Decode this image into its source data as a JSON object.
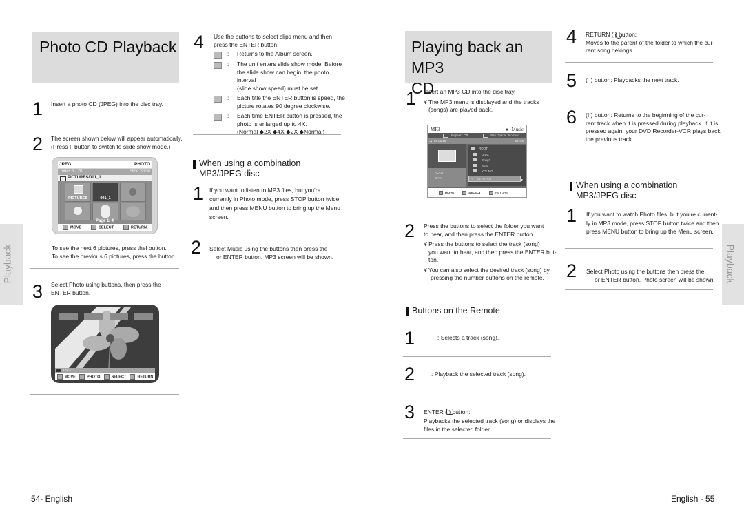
{
  "left_page": {
    "title": "Photo CD Playback",
    "side_tab": "Playback",
    "steps": [
      {
        "num": "1",
        "text": "Insert a photo CD (JPEG) into the disc tray."
      },
      {
        "num": "2",
        "text_line1": "The screen shown below will appear automatically.",
        "text_line2": "(Press   II button to switch to slide show mode.)"
      },
      {
        "num": "3",
        "text_line1": "Select Photo using      buttons, then press the",
        "text_line2": "ENTER button."
      }
    ],
    "nav_note_line1": "To see the next 6 pictures, press thel  button.",
    "nav_note_line2": "To see the previous 6 pictures, press the  button.",
    "screen1": {
      "top_left": "JPEG",
      "top_right": "PHOTO",
      "index": "Index   1 /  20",
      "slide_show": "Slide Show",
      "folder": "PICTURES/001_1",
      "thumb_labels": [
        "PICTURES",
        "001_1",
        "",
        "",
        "",
        ""
      ],
      "page": "Page 1/  4",
      "footer": [
        "MOVE",
        "SELECT",
        "RETURN"
      ]
    },
    "screen2": {
      "file": "05/31",
      "footer": [
        "MOVE",
        "PHOTO",
        "SELECT",
        "RETURN"
      ],
      "icons": [
        "grid-icon",
        "slideshow-icon",
        "rotate-icon",
        "zoom-icon"
      ]
    },
    "step4": {
      "num": "4",
      "text_line1": "Use the        buttons to select clips menu and then",
      "text_line2": "press the ENTER button.",
      "items": [
        {
          "icon": "album-grid-icon",
          "lines": [
            "Returns to the Album screen."
          ]
        },
        {
          "icon": "slideshow-icon",
          "lines": [
            "The unit enters slide show mode. Before",
            "the slide show can begin, the photo interval",
            "(slide show speed) must be set"
          ]
        },
        {
          "icon": "rotate-icon",
          "lines": [
            "Each title the ENTER button is speed, the",
            "picture rotates 90 degree clockwise."
          ]
        },
        {
          "icon": "zoom-icon",
          "lines": [
            "Each time ENTER button is pressed, the",
            "photo is enlarged up to 4X.",
            "(Normal ◆2X ◆4X ◆2X ◆Normal)"
          ]
        }
      ]
    },
    "combo": {
      "heading_line1": "When using a combination",
      "heading_line2": "MP3/JPEG disc",
      "step1_num": "1",
      "step1_lines": [
        "If you want to listen to MP3 files, but you're",
        "currently in Photo mode, press STOP button twice",
        "and then press MENU button to bring up the Menu",
        "screen."
      ],
      "step2_num": "2",
      "step2_lines": [
        "Select Music using the       buttons then press the",
        "or ENTER button. MP3 screen will be shown."
      ]
    },
    "footer": "54- English"
  },
  "right_page": {
    "title_line1": "Playing back an MP3",
    "title_line2": "CD",
    "side_tab": "Playback",
    "step1": {
      "num": "1",
      "text": "Insert an MP3 CD into the disc tray.",
      "bullet_lines": [
        "¥ The MP3 menu is displayed and the tracks",
        "(songs) are played back."
      ]
    },
    "mp3_screen": {
      "title": "MP3",
      "mode": "Music",
      "repeat": "Repeat : Off",
      "play_option": "Play Option : Normal",
      "track_time_left": "08 L1.18",
      "time_right": "00 :35",
      "folders": [
        "ROOT",
        "DISC",
        "Song2",
        "SES",
        "YOUNG"
      ],
      "selected_track": "01 INTRO",
      "left_items": [
        "ROOT",
        "DATA"
      ],
      "footer": [
        "MOVE",
        "SELECT",
        "RETURN"
      ]
    },
    "step2": {
      "num": "2",
      "lines": [
        "Press the        buttons to select the folder you want",
        "to hear, and then press the ENTER button."
      ],
      "bullet1": [
        "¥ Press the        buttons to select the track (song)",
        "you want to hear, and then press the ENTER but-",
        "ton."
      ],
      "bullet2": [
        "¥  You can also select the desired track (song) by",
        "pressing the number buttons on the remote."
      ]
    },
    "remote": {
      "heading": "Buttons on the Remote",
      "items": [
        {
          "num": "1",
          "lines": [
            ": Selects a track (song)."
          ]
        },
        {
          "num": "2",
          "lines": [
            ": Playback the selected track (song)."
          ]
        },
        {
          "num": "3",
          "lines": [
            "ENTER (   ) button:",
            "Playbacks the selected track (song) or displays the",
            "files in the selected folder."
          ]
        },
        {
          "num": "4",
          "lines": [
            "RETURN (   ) button:",
            "Moves to the parent of the folder to which the cur-",
            "rent song belongs."
          ]
        },
        {
          "num": "5",
          "lines": [
            "(    I) button: Playbacks the next track."
          ]
        },
        {
          "num": "6",
          "lines": [
            "(I    ) button: Returns to the beginning of the cur-",
            "rent track when it is pressed during playback. If it is",
            "pressed again, your DVD Recorder-VCR plays back",
            "the previous track."
          ]
        }
      ]
    },
    "combo": {
      "heading_line1": "When using a combination",
      "heading_line2": "MP3/JPEG disc",
      "step1_num": "1",
      "step1_lines": [
        "If you want to watch Photo files, but you're current-",
        "ly in MP3 mode, press STOP button twice and then",
        "press MENU button to bring up the Menu screen."
      ],
      "step2_num": "2",
      "step2_lines": [
        "Select Photo using the       buttons then press the",
        "or ENTER button. Photo screen will be shown."
      ]
    },
    "footer": "English - 55"
  }
}
